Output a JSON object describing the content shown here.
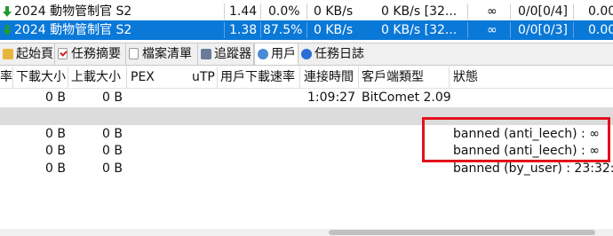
{
  "tasks": [
    {
      "name": "2024 動物管制官 S2",
      "size": "1.44 ...",
      "progress": "0.0%",
      "down_speed": "0 KB/s",
      "up_speed": "0 KB/s [32...",
      "infinity": "∞",
      "seeds": "0/0[0/4]",
      "extra": "0.00",
      "selected": false,
      "icon": "green-down-arrow-icon"
    },
    {
      "name": "2024 動物管制官 S2",
      "size": "1.38 ...",
      "progress": "87.5%",
      "down_speed": "0 KB/s",
      "up_speed": "0 KB/s [32...",
      "infinity": "∞",
      "seeds": "0/0[0/3]",
      "extra": "0.00",
      "selected": true,
      "icon": "green-down-arrow-icon"
    }
  ],
  "tabs": [
    {
      "label": "起始頁",
      "icon": "home-icon",
      "active": false
    },
    {
      "label": "任務摘要",
      "icon": "checklist-icon",
      "active": false
    },
    {
      "label": "檔案清單",
      "icon": "file-list-icon",
      "active": false
    },
    {
      "label": "追蹤器",
      "icon": "tracker-icon",
      "active": false
    },
    {
      "label": "用戶",
      "icon": "user-icon",
      "active": true
    },
    {
      "label": "任務日誌",
      "icon": "info-icon",
      "active": false
    }
  ],
  "columns": {
    "rate": "率",
    "downloaded": "下載大小",
    "uploaded": "上載大小",
    "pex": "PEX",
    "utp": "uTP",
    "user_down_speed": "用戶下載速率",
    "connect_time": "連接時間",
    "client_type": "客戶端類型",
    "status": "狀態"
  },
  "peers": [
    {
      "downloaded": "0 B",
      "uploaded": "0 B",
      "connect_time": "1:09:27",
      "client": "BitComet 2.09",
      "status": ""
    },
    {
      "downloaded": "",
      "uploaded": "",
      "connect_time": "",
      "client": "",
      "status": ""
    },
    {
      "downloaded": "0 B",
      "uploaded": "0 B",
      "connect_time": "",
      "client": "",
      "status": "banned (anti_leech) : ∞"
    },
    {
      "downloaded": "0 B",
      "uploaded": "0 B",
      "connect_time": "",
      "client": "",
      "status": "banned (anti_leech) : ∞"
    },
    {
      "downloaded": "0 B",
      "uploaded": "0 B",
      "connect_time": "",
      "client": "",
      "status": "banned (by_user) : 23:32:..."
    }
  ],
  "colors": {
    "selection": "#0a78d7",
    "highlight_box": "#e3101b",
    "gray_band": "#dcdcdc"
  }
}
